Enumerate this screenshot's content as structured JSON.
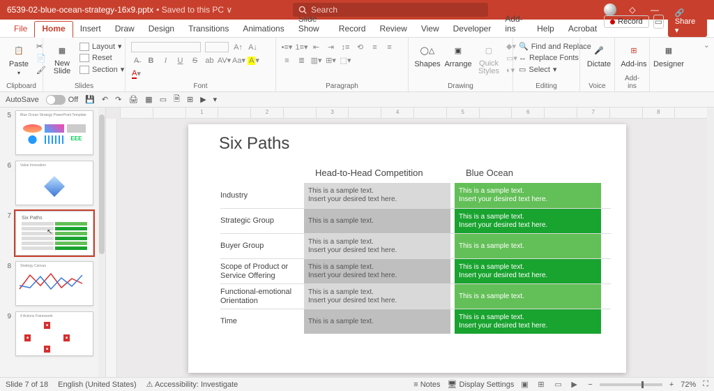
{
  "titlebar": {
    "filename": "6539-02-blue-ocean-strategy-16x9.pptx",
    "saved_state": "Saved to this PC",
    "search_placeholder": "Search"
  },
  "tabs": {
    "file": "File",
    "home": "Home",
    "insert": "Insert",
    "draw": "Draw",
    "design": "Design",
    "transitions": "Transitions",
    "animations": "Animations",
    "slideshow": "Slide Show",
    "record": "Record",
    "review": "Review",
    "view": "View",
    "developer": "Developer",
    "addins": "Add-ins",
    "help": "Help",
    "acrobat": "Acrobat",
    "record_btn": "Record",
    "share_btn": "Share"
  },
  "ribbon": {
    "clipboard": {
      "label": "Clipboard",
      "paste": "Paste"
    },
    "slides": {
      "label": "Slides",
      "newslide": "New\nSlide",
      "layout": "Layout",
      "reset": "Reset",
      "section": "Section"
    },
    "font": {
      "label": "Font"
    },
    "paragraph": {
      "label": "Paragraph"
    },
    "drawing": {
      "label": "Drawing",
      "shapes": "Shapes",
      "arrange": "Arrange",
      "quick": "Quick\nStyles"
    },
    "editing": {
      "label": "Editing",
      "find": "Find and Replace",
      "replace": "Replace Fonts",
      "select": "Select"
    },
    "voice": {
      "label": "Voice",
      "dictate": "Dictate"
    },
    "addins": {
      "label": "Add-ins",
      "btn": "Add-ins"
    },
    "designer": {
      "label": "Designer",
      "btn": "Designer"
    }
  },
  "autosave": {
    "label": "AutoSave",
    "state": "Off"
  },
  "slide": {
    "title": "Six Paths",
    "head_a": "Head-to-Head Competition",
    "head_b": "Blue Ocean",
    "rows": [
      {
        "label": "Industry",
        "c1a": "This is a sample text.",
        "c1b": "Insert your desired text here.",
        "c2a": "This is a sample text.",
        "c2b": "Insert your desired text here.",
        "g": "g1",
        "alt": false
      },
      {
        "label": "Strategic Group",
        "c1a": "This is a sample text.",
        "c1b": "",
        "c2a": "This is a sample text.",
        "c2b": "Insert your desired text here.",
        "g": "g2",
        "alt": true
      },
      {
        "label": "Buyer Group",
        "c1a": "This is a sample text.",
        "c1b": "Insert your desired text here.",
        "c2a": "This is a sample text.",
        "c2b": "",
        "g": "g1",
        "alt": false
      },
      {
        "label": "Scope of Product or Service Offering",
        "c1a": "This is a sample text.",
        "c1b": "Insert your desired text here.",
        "c2a": "This is a sample text.",
        "c2b": "Insert your desired text here.",
        "g": "g2",
        "alt": true
      },
      {
        "label": "Functional-emotional Orientation",
        "c1a": "This is a sample text.",
        "c1b": "Insert your desired text here.",
        "c2a": "This is a sample text.",
        "c2b": "",
        "g": "g1",
        "alt": false
      },
      {
        "label": "Time",
        "c1a": "This is a sample text.",
        "c1b": "",
        "c2a": "This is a sample text.",
        "c2b": "Insert your desired text here.",
        "g": "g2",
        "alt": true
      }
    ]
  },
  "thumbs": {
    "nums": [
      "5",
      "6",
      "7",
      "8",
      "9"
    ],
    "t5_title": "Blue Ocean Strategy PowerPoint Template",
    "t6_title": "Value Innovation",
    "t7_title": "Six Paths",
    "t8_title": "Strategy Canvas",
    "t9_title": "4 Actions Framework"
  },
  "ruler": {
    "ticks": [
      "",
      "",
      "1",
      "",
      "2",
      "",
      "3",
      "",
      "4",
      "",
      "5",
      "",
      "6",
      "",
      "7",
      "",
      "8",
      ""
    ]
  },
  "status": {
    "slide": "Slide 7 of 18",
    "lang": "English (United States)",
    "access": "Accessibility: Investigate",
    "notes": "Notes",
    "display": "Display Settings",
    "zoom": "72%"
  }
}
